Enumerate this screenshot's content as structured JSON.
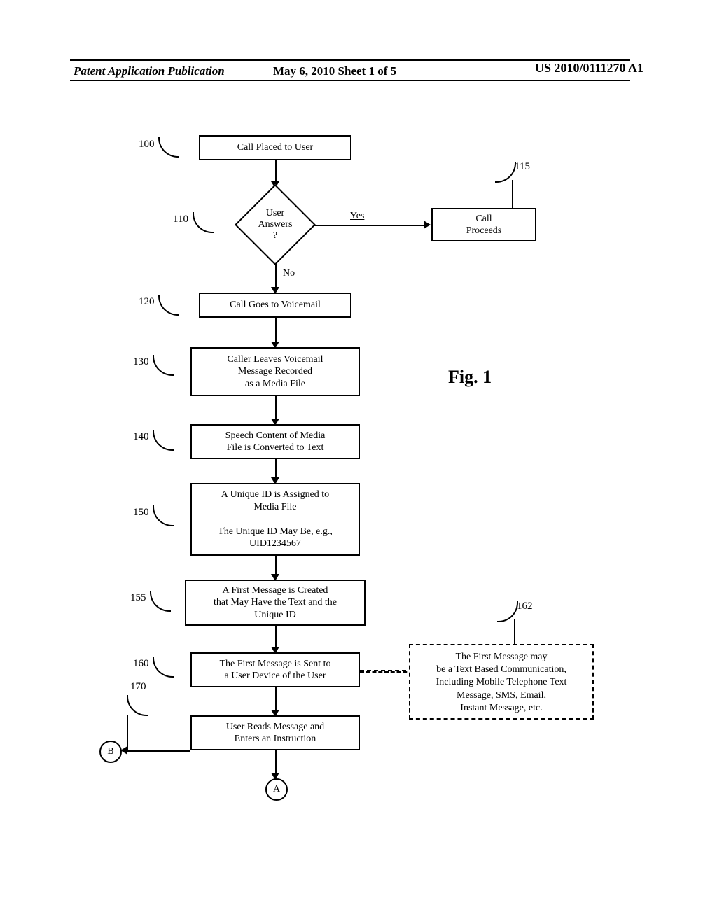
{
  "header": {
    "left": "Patent Application Publication",
    "mid": "May 6, 2010   Sheet 1 of 5",
    "right": "US 2010/0111270 A1"
  },
  "figure_label": "Fig. 1",
  "refs": {
    "r100": "100",
    "r110": "110",
    "r115": "115",
    "r120": "120",
    "r130": "130",
    "r140": "140",
    "r150": "150",
    "r155": "155",
    "r160": "160",
    "r162": "162",
    "r170": "170"
  },
  "steps": {
    "s100": "Call Placed to User",
    "s115": "Call\nProceeds",
    "s120": "Call Goes to Voicemail",
    "s130": "Caller Leaves Voicemail\nMessage Recorded\nas a Media File",
    "s140": "Speech Content of Media\nFile is Converted to Text",
    "s150": "A Unique ID is Assigned to\nMedia File\n\nThe Unique ID May Be, e.g.,\nUID1234567",
    "s155": "A First Message is Created\nthat May Have the Text and the\nUnique ID",
    "s160": "The First Message is Sent to\na User Device of the User",
    "s170": "User Reads Message and\nEnters an Instruction"
  },
  "decision": {
    "label": "User\nAnswers\n?",
    "yes": "Yes",
    "no": "No"
  },
  "note162": "The First Message may\nbe a Text Based Communication,\nIncluding Mobile Telephone Text\nMessage, SMS, Email,\nInstant Message, etc.",
  "connectors": {
    "A": "A",
    "B": "B"
  }
}
